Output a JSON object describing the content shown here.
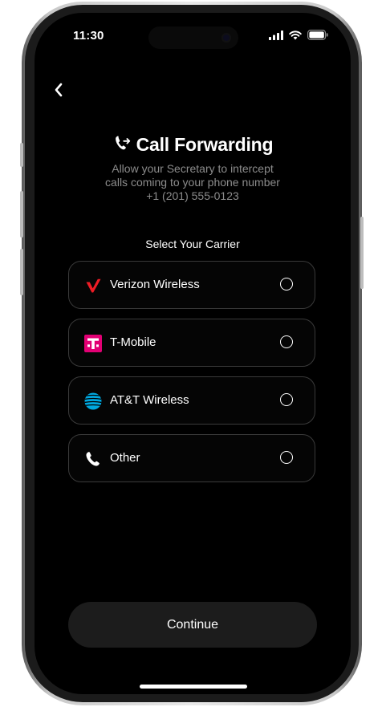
{
  "status_bar": {
    "time": "11:30",
    "icons": [
      "cellular-signal-icon",
      "wifi-icon",
      "battery-icon"
    ]
  },
  "header": {
    "back_icon": "chevron-left-icon",
    "title_icon": "call-forward-icon",
    "title": "Call Forwarding",
    "subtitle_line1": "Allow your Secretary to intercept",
    "subtitle_line2": "calls coming to your phone number",
    "phone_number": "+1 (201) 555-0123"
  },
  "carrier_section": {
    "label": "Select Your Carrier",
    "carriers": [
      {
        "label": "Verizon Wireless",
        "icon": "verizon-logo-icon",
        "selected": false
      },
      {
        "label": "T-Mobile",
        "icon": "t-mobile-logo-icon",
        "selected": false
      },
      {
        "label": "AT&T Wireless",
        "icon": "att-logo-icon",
        "selected": false
      },
      {
        "label": "Other",
        "icon": "phone-icon",
        "selected": false
      }
    ]
  },
  "footer": {
    "continue_label": "Continue"
  },
  "colors": {
    "screen_bg": "#000000",
    "card_border": "#3a3a3a",
    "button_bg": "#1c1c1c",
    "subtitle": "#8c8c8c",
    "verizon_red": "#ee1c25",
    "tmobile_magenta": "#e20074",
    "att_blue": "#00a8e0"
  }
}
